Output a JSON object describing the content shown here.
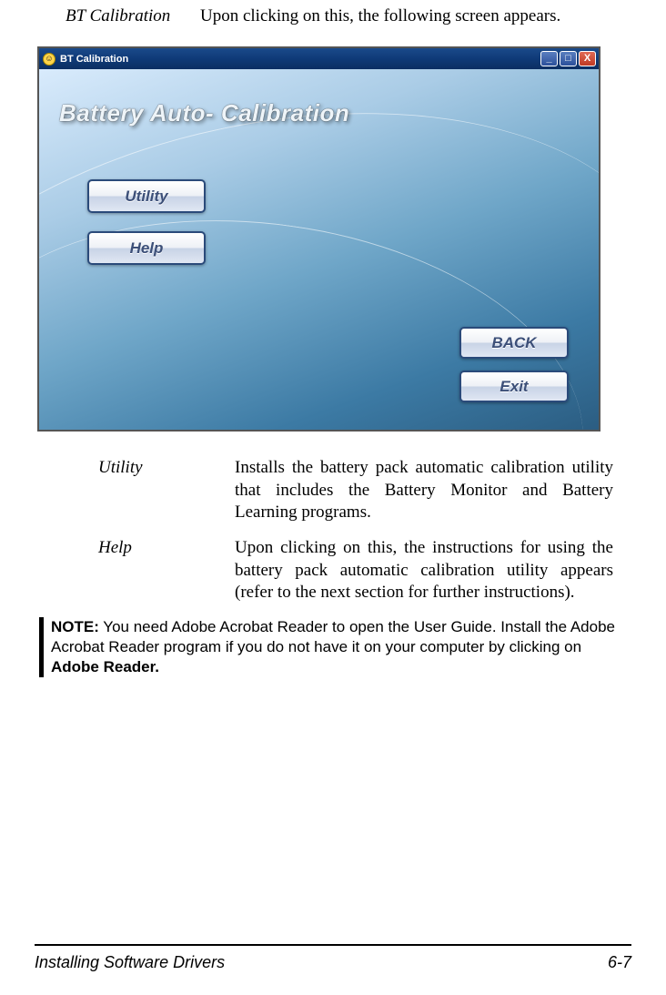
{
  "lead": {
    "term": "BT Calibration",
    "desc": "Upon clicking on this, the following screen appears."
  },
  "window": {
    "title": "BT Calibration",
    "app_title": "Battery Auto- Calibration",
    "controls": {
      "min": "_",
      "max": "□",
      "close": "X"
    },
    "buttons": {
      "utility": "Utility",
      "help": "Help",
      "back": "BACK",
      "exit": "Exit"
    }
  },
  "descs": [
    {
      "term": "Utility",
      "def": "Installs the battery pack automatic calibration utility that includes the Battery Monitor and Battery Learning programs."
    },
    {
      "term": "Help",
      "def": "Upon clicking on this, the instructions for using the battery pack automatic calibration utility appears (refer to the next section for further instructions)."
    }
  ],
  "note": {
    "label": "NOTE:",
    "body_a": " You need Adobe Acrobat Reader to open the User Guide. Install the Adobe Acrobat Reader program if you do not have it on your computer by clicking on ",
    "strong": "Adobe Reader."
  },
  "footer": {
    "left": "Installing Software Drivers",
    "right": "6-7"
  }
}
